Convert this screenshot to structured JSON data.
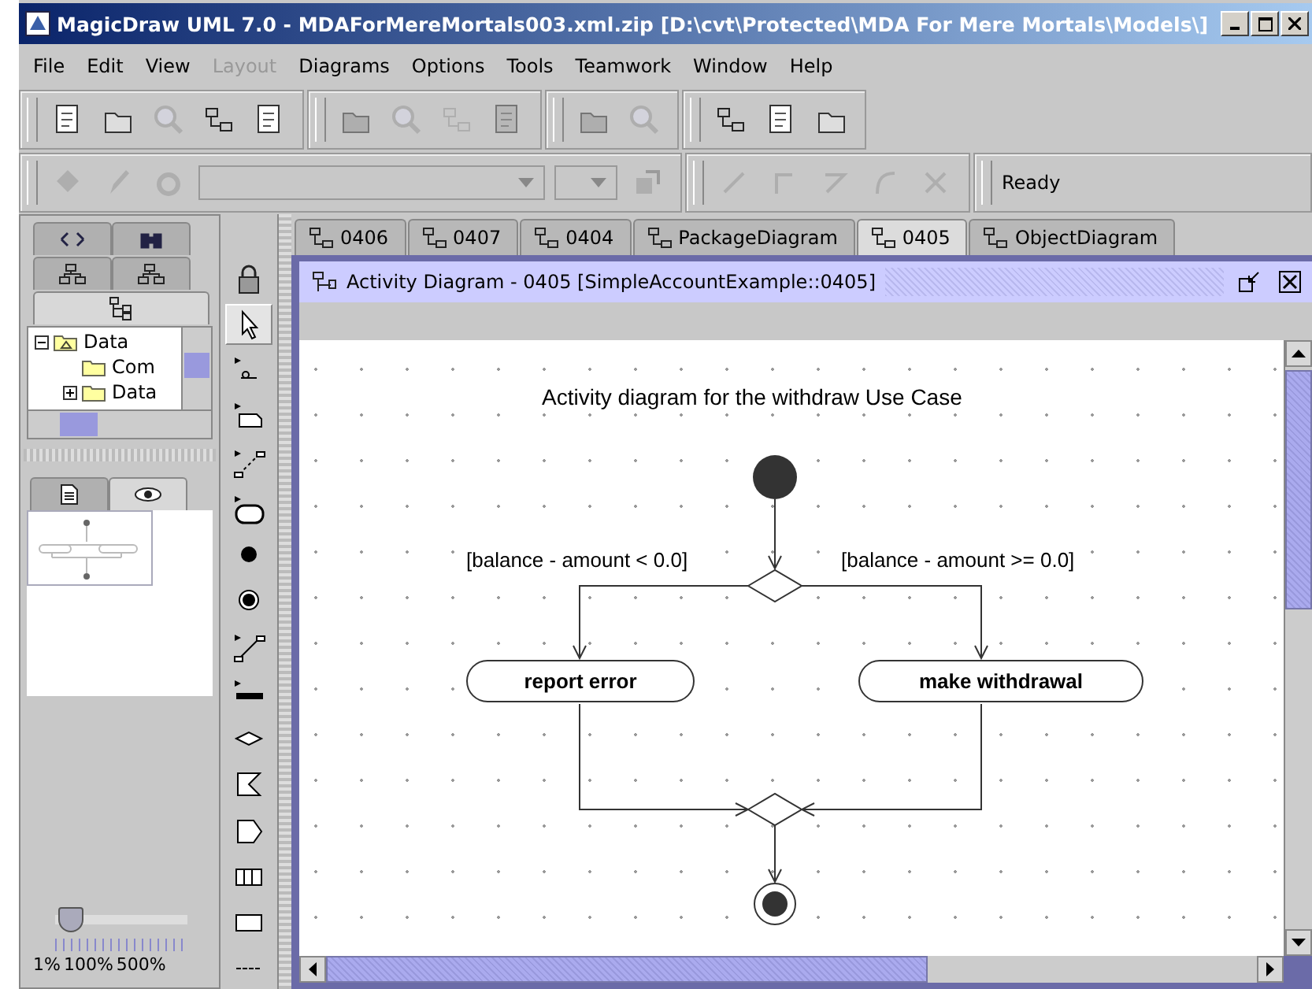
{
  "window": {
    "title": "MagicDraw UML 7.0 - MDAForMereMortals003.xml.zip [D:\\cvt\\Protected\\MDA For Mere Mortals\\Models\\]"
  },
  "menu": [
    {
      "label": "File",
      "disabled": false
    },
    {
      "label": "Edit",
      "disabled": false
    },
    {
      "label": "View",
      "disabled": false
    },
    {
      "label": "Layout",
      "disabled": true
    },
    {
      "label": "Diagrams",
      "disabled": false
    },
    {
      "label": "Options",
      "disabled": false
    },
    {
      "label": "Tools",
      "disabled": false
    },
    {
      "label": "Teamwork",
      "disabled": false
    },
    {
      "label": "Window",
      "disabled": false
    },
    {
      "label": "Help",
      "disabled": false
    }
  ],
  "toolbar": [
    {
      "disabled": false
    },
    {
      "disabled": false
    },
    {
      "disabled": true
    },
    {
      "disabled": false
    },
    {
      "disabled": false
    },
    {
      "disabled": true
    },
    {
      "disabled": true
    },
    {
      "disabled": true
    },
    {
      "disabled": true
    },
    {
      "disabled": true
    },
    {
      "disabled": true
    },
    {
      "disabled": false
    },
    {
      "disabled": false
    },
    {
      "disabled": false
    }
  ],
  "status": "Ready",
  "browser_tabs": [
    {
      "selected": false
    },
    {
      "selected": false
    },
    {
      "selected": false
    },
    {
      "selected": false
    },
    {
      "selected": true
    }
  ],
  "tree": [
    {
      "label": "Data",
      "expanded": true,
      "children": [
        {
          "label": "Com"
        },
        {
          "label": "Data",
          "expanded": false
        }
      ]
    }
  ],
  "view_tabs": [
    {
      "selected": false
    },
    {
      "selected": true
    }
  ],
  "zoom": {
    "level": 0.12,
    "min": "1%",
    "mid": "100%",
    "max": "500%"
  },
  "palette": [
    {
      "kind": "lock",
      "selected": false
    },
    {
      "kind": "pointer",
      "selected": true
    },
    {
      "kind": "text",
      "selected": false
    },
    {
      "kind": "note",
      "selected": false
    },
    {
      "kind": "anchor",
      "selected": false
    },
    {
      "kind": "action",
      "selected": false
    },
    {
      "kind": "initial",
      "selected": false
    },
    {
      "kind": "final",
      "selected": false
    },
    {
      "kind": "flow",
      "selected": false
    },
    {
      "kind": "bar",
      "selected": false
    },
    {
      "kind": "decision",
      "selected": false
    },
    {
      "kind": "receive",
      "selected": false
    },
    {
      "kind": "send",
      "selected": false
    },
    {
      "kind": "swimlane",
      "selected": false
    },
    {
      "kind": "object",
      "selected": false
    },
    {
      "kind": "separator",
      "selected": false
    }
  ],
  "diagram_tabs": [
    {
      "label": "0406",
      "selected": false
    },
    {
      "label": "0407",
      "selected": false
    },
    {
      "label": "0404",
      "selected": false
    },
    {
      "label": "PackageDiagram",
      "selected": false
    },
    {
      "label": "0405",
      "selected": true
    },
    {
      "label": "ObjectDiagram",
      "selected": false
    }
  ],
  "diagram_window": {
    "title": "Activity Diagram - 0405 [SimpleAccountExample::0405]"
  },
  "diagram": {
    "title": "Activity diagram for the withdraw Use Case",
    "guards": [
      "[balance - amount < 0.0]",
      "[balance - amount >= 0.0]"
    ],
    "actions": [
      "report error",
      "make withdrawal"
    ]
  }
}
